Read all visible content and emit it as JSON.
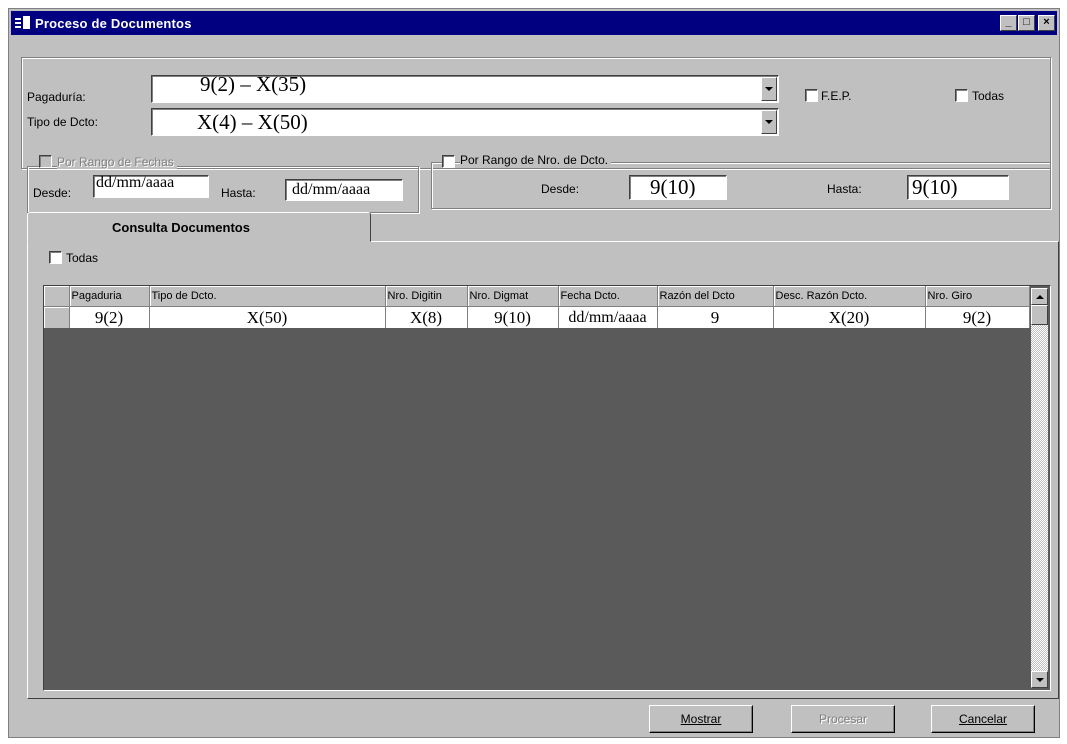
{
  "window": {
    "title": "Proceso de Documentos",
    "controls": [
      "_",
      "□",
      "×"
    ]
  },
  "filters": {
    "pagaduria_label": "Pagaduría:",
    "pagaduria_value": "9(2) – X(35)",
    "tipo_label": "Tipo de Dcto:",
    "tipo_value": "X(4) – X(50)",
    "fep_label": "F.E.P.",
    "todas_label": "Todas"
  },
  "fecha_range": {
    "title": "Por Rango de Fechas",
    "desde_label": "Desde:",
    "desde_value": "dd/mm/aaaa",
    "hasta_label": "Hasta:",
    "hasta_value": "dd/mm/aaaa"
  },
  "nro_range": {
    "title": "Por Rango de Nro. de Dcto.",
    "desde_label": "Desde:",
    "desde_value": "9(10)",
    "hasta_label": "Hasta:",
    "hasta_value": "9(10)"
  },
  "tab": {
    "label": "Consulta Documentos",
    "todas_label": "Todas"
  },
  "grid": {
    "columns": [
      "Pagaduria",
      "Tipo de Dcto.",
      "Nro. Digitin",
      "Nro. Digmat",
      "Fecha Dcto.",
      "Razón del Dcto",
      "Desc. Razón Dcto.",
      "Nro. Giro"
    ],
    "rows": [
      [
        "9(2)",
        "X(50)",
        "X(8)",
        "9(10)",
        "dd/mm/aaaa",
        "9",
        "X(20)",
        "9(2)"
      ]
    ]
  },
  "buttons": {
    "mostrar": "Mostrar",
    "procesar": "Procesar",
    "cancelar": "Cancelar"
  },
  "colors": {
    "titlebar": "#000080",
    "face": "#c0c0c0",
    "grid_bg": "#5a5a5a"
  }
}
